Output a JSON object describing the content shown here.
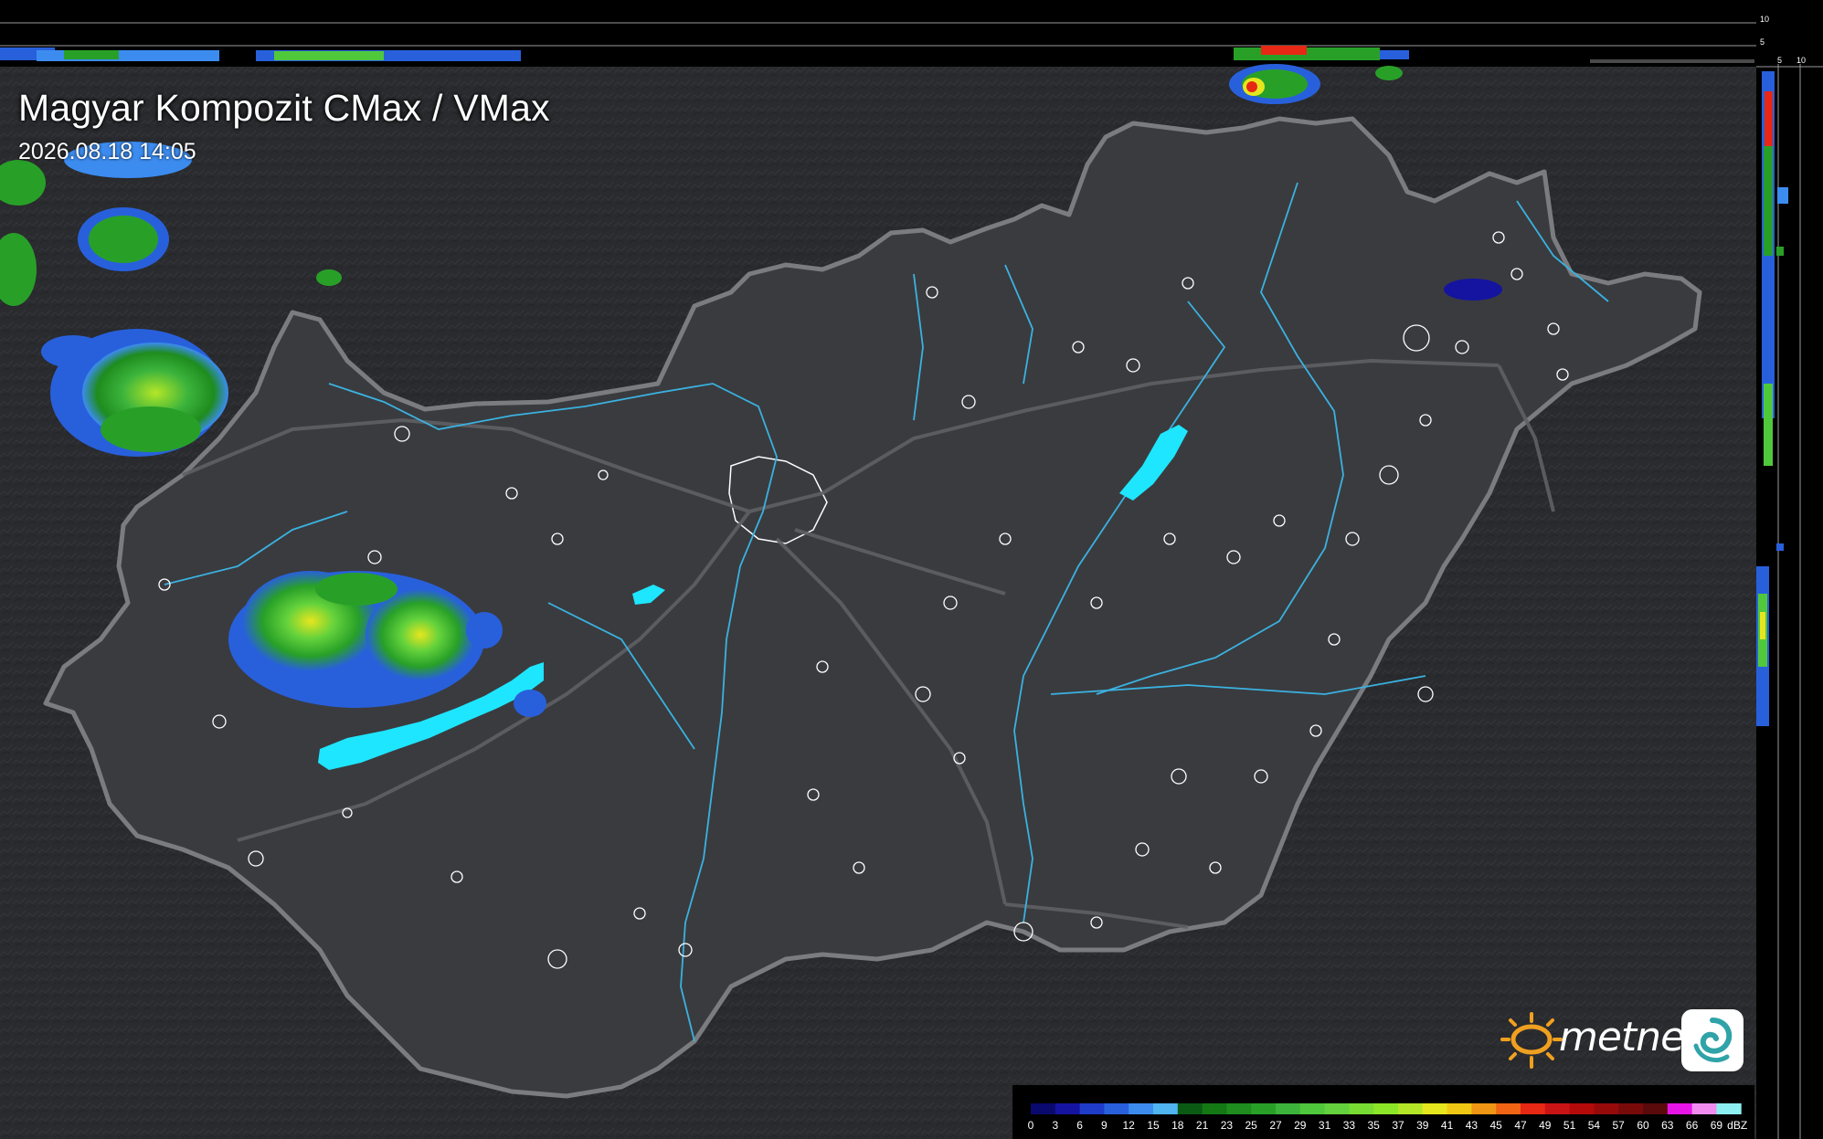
{
  "header": {
    "title": "Magyar Kompozit CMax / VMax",
    "timestamp": "2026.08.18 14:05"
  },
  "brand": {
    "name": "metnet",
    "sun_color": "#f0a020",
    "logo_color": "#2fa3a8"
  },
  "legend": {
    "unit": "dBZ",
    "labels": [
      "0",
      "3",
      "6",
      "9",
      "12",
      "15",
      "18",
      "21",
      "23",
      "25",
      "27",
      "29",
      "31",
      "33",
      "35",
      "37",
      "39",
      "41",
      "43",
      "45",
      "47",
      "49",
      "51",
      "54",
      "57",
      "60",
      "63",
      "66",
      "69"
    ],
    "colors": [
      "#0a0a6e",
      "#1414a0",
      "#1e3cc8",
      "#2860dc",
      "#3c8cf0",
      "#50b4f0",
      "#0a5a14",
      "#147814",
      "#1e8c1e",
      "#28a028",
      "#3cb43c",
      "#50c83c",
      "#64d23c",
      "#78dc32",
      "#8ce628",
      "#b4e628",
      "#e6e61e",
      "#f0c814",
      "#f09614",
      "#f06414",
      "#e62814",
      "#c81414",
      "#b40a0a",
      "#960a0a",
      "#780a0a",
      "#5a0a0a",
      "#e614e6",
      "#f08cf0",
      "#8cf0f0"
    ]
  },
  "side_profile": {
    "tick_labels": [
      "10",
      "5",
      "5",
      "10"
    ]
  },
  "map": {
    "background_color": "#2d2e31",
    "country_fill": "#3a3b3f",
    "border_color": "#7b7c80",
    "river_color": "#3ab2e0",
    "lake_color": "#1ee6ff",
    "town_outline_color": "#ffffff"
  }
}
